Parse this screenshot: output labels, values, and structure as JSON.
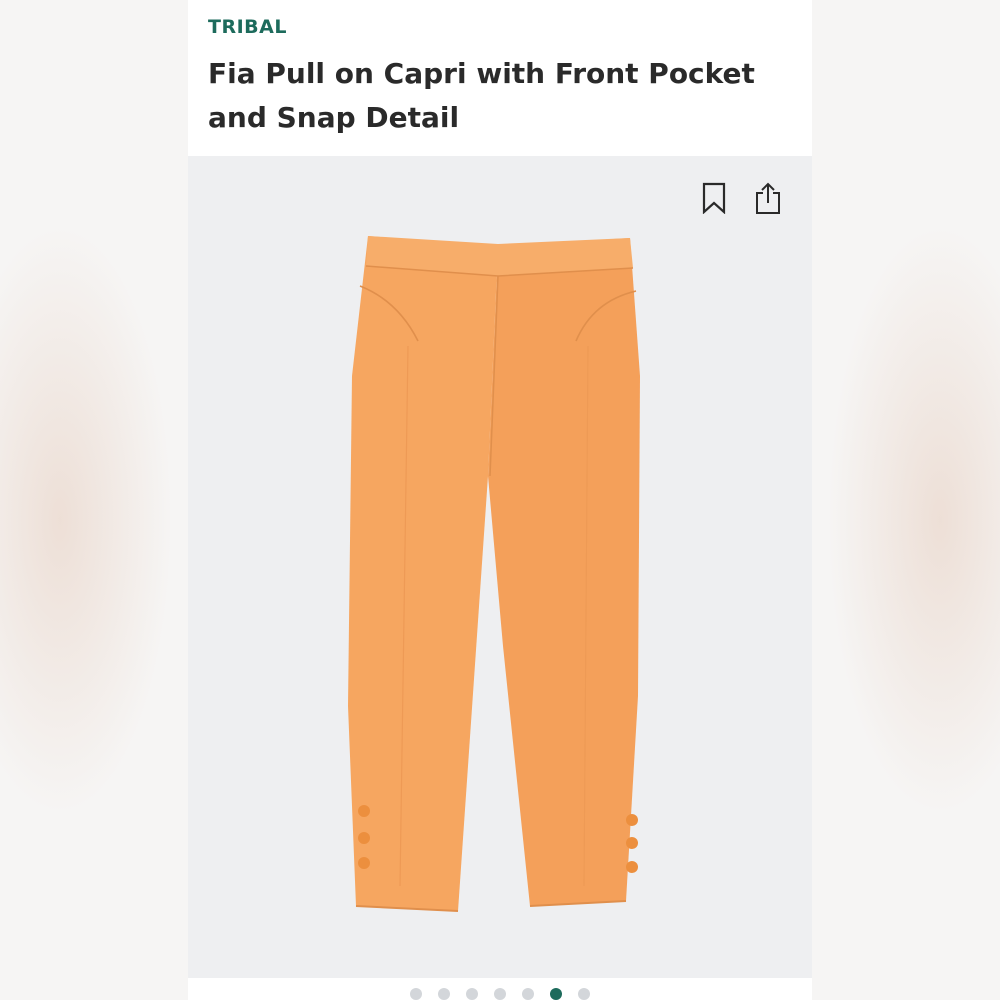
{
  "product": {
    "brand": "TRIBAL",
    "title": "Fia Pull on Capri with Front Pocket and Snap Detail",
    "color": "#f6a660"
  },
  "actions": {
    "bookmark_icon": "bookmark-icon",
    "share_icon": "share-icon"
  },
  "carousel": {
    "total": 7,
    "active_index": 5
  },
  "colors": {
    "brand_text": "#1d6b5c",
    "title_text": "#2a2a2a",
    "gallery_bg": "#eeeff1",
    "dot_inactive": "#d3d6da",
    "dot_active": "#1d6b5c"
  }
}
